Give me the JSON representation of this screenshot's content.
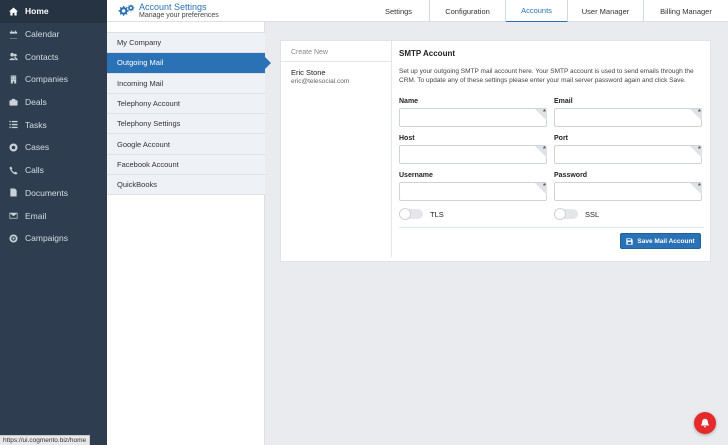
{
  "sidebar": {
    "items": [
      {
        "label": "Home",
        "icon": "home-icon",
        "active": true
      },
      {
        "label": "Calendar",
        "icon": "calendar-icon"
      },
      {
        "label": "Contacts",
        "icon": "contacts-icon"
      },
      {
        "label": "Companies",
        "icon": "companies-icon"
      },
      {
        "label": "Deals",
        "icon": "deals-icon"
      },
      {
        "label": "Tasks",
        "icon": "tasks-icon"
      },
      {
        "label": "Cases",
        "icon": "cases-icon"
      },
      {
        "label": "Calls",
        "icon": "calls-icon"
      },
      {
        "label": "Documents",
        "icon": "documents-icon"
      },
      {
        "label": "Email",
        "icon": "email-icon"
      },
      {
        "label": "Campaigns",
        "icon": "campaigns-icon"
      }
    ]
  },
  "header": {
    "title": "Account Settings",
    "subtitle": "Manage your preferences",
    "tabs": [
      {
        "label": "Settings"
      },
      {
        "label": "Configuration"
      },
      {
        "label": "Accounts",
        "active": true
      },
      {
        "label": "User Manager"
      },
      {
        "label": "Billing Manager"
      }
    ]
  },
  "settings_menu": {
    "items": [
      {
        "label": "My Company"
      },
      {
        "label": "Outgoing Mail",
        "active": true
      },
      {
        "label": "Incoming Mail"
      },
      {
        "label": "Telephony Account"
      },
      {
        "label": "Telephony Settings"
      },
      {
        "label": "Google Account"
      },
      {
        "label": "Facebook Account"
      },
      {
        "label": "QuickBooks"
      }
    ]
  },
  "accounts": {
    "create_new": "Create New",
    "list": [
      {
        "name": "Eric Stone",
        "email": "eric@telesocial.com"
      }
    ]
  },
  "smtp_form": {
    "title": "SMTP Account",
    "description": "Set up your outgoing SMTP mail account here. Your SMTP account is used to send emails through the CRM. To update any of these settings please enter your mail server password again and click Save.",
    "fields": {
      "name": {
        "label": "Name",
        "value": ""
      },
      "email": {
        "label": "Email",
        "value": ""
      },
      "host": {
        "label": "Host",
        "value": ""
      },
      "port": {
        "label": "Port",
        "value": ""
      },
      "username": {
        "label": "Username",
        "value": ""
      },
      "password": {
        "label": "Password",
        "value": ""
      }
    },
    "required_mark": "*",
    "toggles": {
      "tls": {
        "label": "TLS",
        "on": false
      },
      "ssl": {
        "label": "SSL",
        "on": false
      }
    },
    "save_label": "Save Mail Account"
  },
  "status_bar": {
    "url": "https://ui.cogmento.biz/home"
  },
  "colors": {
    "sidebar_bg": "#2e3d4f",
    "accent": "#2a72b5",
    "notification": "#e42a2a"
  }
}
